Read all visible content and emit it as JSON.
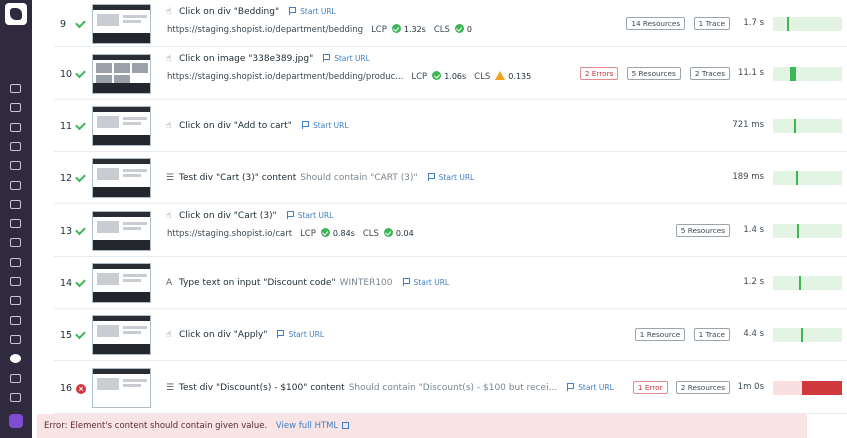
{
  "sidebar": {
    "icons": [
      "search-icon",
      "binoculars-icon",
      "dashboard-icon",
      "chart-icon",
      "integrations-icon",
      "apm-icon",
      "infrastructure-icon",
      "puzzle-icon",
      "logs-icon",
      "network-icon",
      "security-icon",
      "rum-icon",
      "notebook-icon",
      "shield-icon",
      "gear-icon",
      "chat-icon",
      "help-icon"
    ]
  },
  "steps": [
    {
      "num": "9",
      "status": "ok",
      "icon": "☝",
      "title": "Click on div \"Bedding\"",
      "suffix": "",
      "start_url": "Start URL",
      "url": "https://staging.shopist.io/department/bedding",
      "lcp_label": "LCP",
      "lcp": "1.32s",
      "cls_label": "CLS",
      "cls": "0",
      "cls_status": "ok",
      "badges": [
        "14 Resources",
        "1 Trace"
      ],
      "err_badges": [],
      "duration": "1.7 s",
      "mark": 0.2
    },
    {
      "num": "10",
      "status": "ok",
      "icon": "☝",
      "title": "Click on image \"338e389.jpg\"",
      "suffix": "",
      "start_url": "Start URL",
      "url": "https://staging.shopist.io/department/bedding/produc...",
      "lcp_label": "LCP",
      "lcp": "1.06s",
      "cls_label": "CLS",
      "cls": "0.135",
      "cls_status": "warn",
      "badges": [
        "5 Resources",
        "2 Traces"
      ],
      "err_badges": [
        "2 Errors"
      ],
      "duration": "11.1 s",
      "mark": 0.25
    },
    {
      "num": "11",
      "status": "ok",
      "icon": "☝",
      "title": "Click on div \"Add to cart\"",
      "suffix": "",
      "start_url": "Start URL",
      "badges": [],
      "err_badges": [],
      "duration": "721 ms",
      "mark": 0.3
    },
    {
      "num": "12",
      "status": "ok",
      "icon": "☰",
      "title": "Test div \"Cart (3)\" content",
      "suffix": "Should contain \"CART (3)\"",
      "start_url": "Start URL",
      "badges": [],
      "err_badges": [],
      "duration": "189 ms",
      "mark": 0.33
    },
    {
      "num": "13",
      "status": "ok",
      "icon": "☝",
      "title": "Click on div \"Cart (3)\"",
      "suffix": "",
      "start_url": "Start URL",
      "url": "https://staging.shopist.io/cart",
      "lcp_label": "LCP",
      "lcp": "0.84s",
      "cls_label": "CLS",
      "cls": "0.04",
      "cls_status": "ok",
      "badges": [
        "5 Resources"
      ],
      "err_badges": [],
      "duration": "1.4 s",
      "mark": 0.35
    },
    {
      "num": "14",
      "status": "ok",
      "icon": "A",
      "title": "Type text on input \"Discount code\"",
      "suffix": "WINTER100",
      "start_url": "Start URL",
      "badges": [],
      "err_badges": [],
      "duration": "1.2 s",
      "mark": 0.38
    },
    {
      "num": "15",
      "status": "ok",
      "icon": "☝",
      "title": "Click on div \"Apply\"",
      "suffix": "",
      "start_url": "Start URL",
      "badges": [
        "1 Resource",
        "1 Trace"
      ],
      "err_badges": [],
      "duration": "4.4 s",
      "mark": 0.4
    },
    {
      "num": "16",
      "status": "err",
      "icon": "☰",
      "title": "Test div \"Discount(s) - $100\" content",
      "suffix": "Should contain \"Discount(s) - $100 but recei...",
      "start_url": "Start URL",
      "badges": [
        "2 Resources"
      ],
      "err_badges": [
        "1 Error"
      ],
      "duration": "1m 0s",
      "mark": 0.42
    }
  ],
  "error": {
    "message": "Error: Element's content should contain given value.",
    "link": "View full HTML"
  },
  "colors": {
    "success": "#3db655",
    "error": "#d0383c",
    "warning": "#f0a31c",
    "link": "#3f7fc6"
  }
}
